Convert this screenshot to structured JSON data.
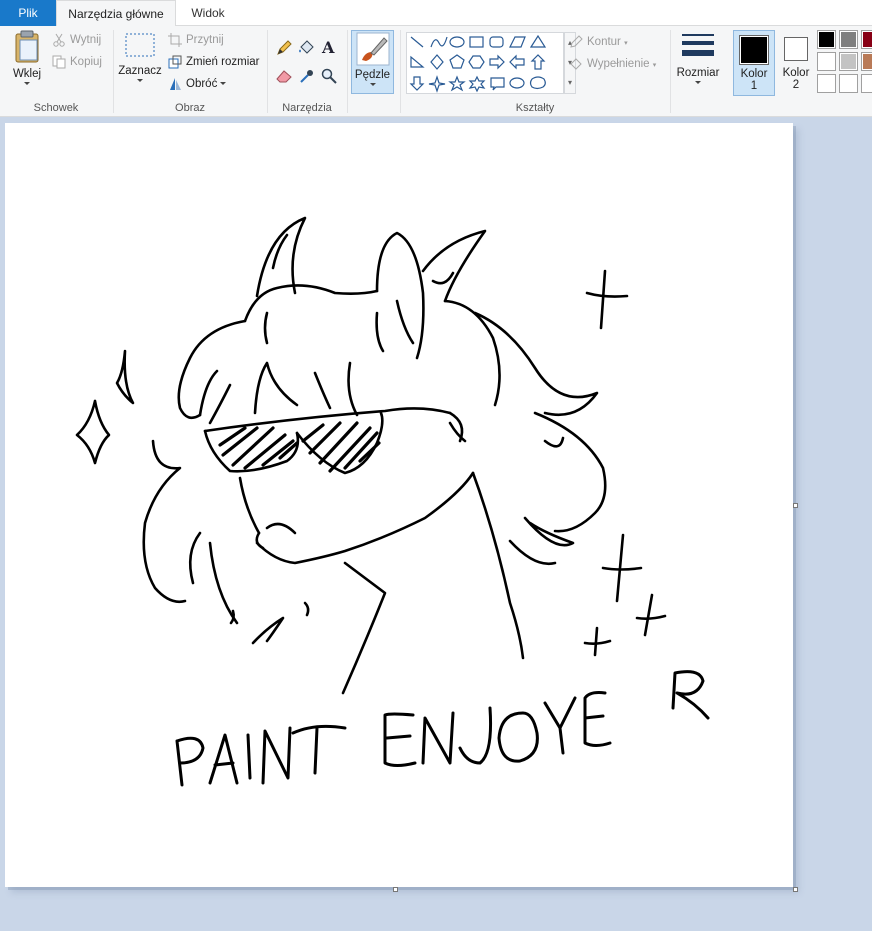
{
  "tabs": {
    "file": "Plik",
    "home": "Narzędzia główne",
    "view": "Widok"
  },
  "clipboard": {
    "paste": "Wklej",
    "cut": "Wytnij",
    "copy": "Kopiuj",
    "label": "Schowek"
  },
  "image": {
    "select": "Zaznacz",
    "crop": "Przytnij",
    "resize": "Zmień rozmiar",
    "rotate": "Obróć",
    "label": "Obraz"
  },
  "tools": {
    "label": "Narzędzia"
  },
  "brushes": {
    "label": "Pędzle"
  },
  "shapes": {
    "outline": "Kontur",
    "fill": "Wypełnienie",
    "label": "Kształty"
  },
  "size": {
    "label": "Rozmiar"
  },
  "colors": {
    "color1_label": "Kolor",
    "color1_num": "1",
    "color2_label": "Kolor",
    "color2_num": "2",
    "color1_value": "#000000",
    "color2_value": "#ffffff",
    "palette": [
      "#000000",
      "#7f7f7f",
      "#880015",
      "#ffffff",
      "#c3c3c3",
      "#b97a57",
      "#ffffff",
      "#ffffff",
      "#ffffff"
    ]
  },
  "drawing": {
    "caption": "PAINT ENJOYER"
  }
}
